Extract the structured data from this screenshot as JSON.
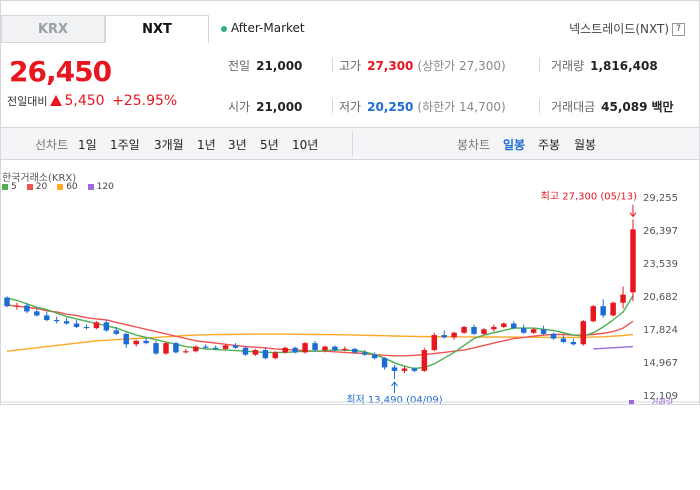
{
  "tabs": [
    {
      "label": "KRX",
      "active": false
    },
    {
      "label": "NXT",
      "active": true
    }
  ],
  "market_status": "After-Market",
  "venue_label": "넥스트레이드(NXT)",
  "venue_help": "?",
  "price": "26,450",
  "change": {
    "label": "전일대비",
    "amount": "5,450",
    "percent": "+25.95%"
  },
  "stats": {
    "prev_close": {
      "label": "전일",
      "value": "21,000"
    },
    "high": {
      "label": "고가",
      "value": "27,300",
      "note": "(상한가 27,300)"
    },
    "volume": {
      "label": "거래량",
      "value": "1,816,408"
    },
    "open": {
      "label": "시가",
      "value": "21,000"
    },
    "low": {
      "label": "저가",
      "value": "20,250",
      "note": "(하한가 14,700)"
    },
    "trade_value": {
      "label": "거래대금",
      "value": "45,089",
      "unit": "백만"
    }
  },
  "toolbar": {
    "line_label": "선차트",
    "line_periods": [
      "1일",
      "1주일",
      "3개월",
      "1년",
      "3년",
      "5년",
      "10년"
    ],
    "candle_label": "봉차트",
    "candle_periods": [
      "일봉",
      "주봉",
      "월봉"
    ],
    "selected_candle": "일봉"
  },
  "chart_data": {
    "type": "candlestick",
    "source_label": "한국거래소(KRX)",
    "legend": [
      {
        "name": "5",
        "color": "#4caf50"
      },
      {
        "name": "20",
        "color": "#ef5350"
      },
      {
        "name": "60",
        "color": "#ffa726"
      },
      {
        "name": "120",
        "color": "#9c6ade"
      }
    ],
    "y_ticks": [
      29255,
      26397,
      23539,
      20682,
      17824,
      14967,
      12109
    ],
    "y_tick_labels": [
      "29,255",
      "26,397",
      "23,539",
      "20,682",
      "17,824",
      "14,967",
      "12,109"
    ],
    "ylim": [
      12109,
      29255
    ],
    "colors": {
      "up": "#e8161f",
      "down": "#1d6cd6"
    },
    "annotations": {
      "high": {
        "label": "최고 27,300 (05/13)",
        "value": 27300,
        "index": 63
      },
      "low": {
        "label": "최저 13,490 (04/09)",
        "value": 13490,
        "index": 39
      }
    },
    "candles": [
      [
        20550,
        20650,
        19700,
        19800
      ],
      [
        19800,
        20100,
        19500,
        19850
      ],
      [
        19850,
        20050,
        19200,
        19350
      ],
      [
        19350,
        19600,
        18900,
        19000
      ],
      [
        19000,
        19300,
        18500,
        18600
      ],
      [
        18600,
        18900,
        18300,
        18500
      ],
      [
        18500,
        18800,
        18200,
        18300
      ],
      [
        18300,
        18600,
        17900,
        18000
      ],
      [
        18000,
        18200,
        17800,
        17900
      ],
      [
        17900,
        18500,
        17800,
        18400
      ],
      [
        18400,
        18600,
        17600,
        17700
      ],
      [
        17700,
        18000,
        17300,
        17400
      ],
      [
        17400,
        17500,
        16200,
        16500
      ],
      [
        16500,
        16900,
        16300,
        16800
      ],
      [
        16800,
        17100,
        16500,
        16600
      ],
      [
        16600,
        16800,
        15600,
        15700
      ],
      [
        15700,
        16700,
        15600,
        16600
      ],
      [
        16600,
        16700,
        15700,
        15800
      ],
      [
        15800,
        16100,
        15700,
        15900
      ],
      [
        15900,
        16400,
        15800,
        16300
      ],
      [
        16300,
        16500,
        16100,
        16200
      ],
      [
        16200,
        16400,
        16000,
        16100
      ],
      [
        16100,
        16500,
        16000,
        16400
      ],
      [
        16400,
        16600,
        16100,
        16200
      ],
      [
        16200,
        16300,
        15500,
        15600
      ],
      [
        15600,
        16100,
        15500,
        16000
      ],
      [
        16000,
        16200,
        15200,
        15300
      ],
      [
        15300,
        15900,
        15200,
        15800
      ],
      [
        15800,
        16300,
        15700,
        16200
      ],
      [
        16200,
        16300,
        15700,
        15800
      ],
      [
        15800,
        16700,
        15700,
        16600
      ],
      [
        16600,
        16800,
        15900,
        16000
      ],
      [
        16000,
        16400,
        15800,
        16300
      ],
      [
        16300,
        16400,
        15900,
        16000
      ],
      [
        16000,
        16300,
        15900,
        16100
      ],
      [
        16100,
        16200,
        15700,
        15800
      ],
      [
        15800,
        16000,
        15500,
        15600
      ],
      [
        15600,
        15800,
        15200,
        15300
      ],
      [
        15300,
        15400,
        14300,
        14500
      ],
      [
        14500,
        14700,
        13490,
        14200
      ],
      [
        14200,
        14600,
        14000,
        14400
      ],
      [
        14400,
        14500,
        14100,
        14200
      ],
      [
        14200,
        16200,
        14100,
        16000
      ],
      [
        16000,
        17500,
        15900,
        17300
      ],
      [
        17300,
        17700,
        17000,
        17100
      ],
      [
        17100,
        17600,
        16900,
        17500
      ],
      [
        17500,
        18100,
        17400,
        18000
      ],
      [
        18000,
        18200,
        17300,
        17400
      ],
      [
        17400,
        17900,
        17300,
        17800
      ],
      [
        17800,
        18200,
        17600,
        18000
      ],
      [
        18000,
        18400,
        17900,
        18300
      ],
      [
        18300,
        18500,
        17800,
        17900
      ],
      [
        17900,
        18200,
        17400,
        17500
      ],
      [
        17500,
        17900,
        17400,
        17800
      ],
      [
        17800,
        18100,
        17300,
        17400
      ],
      [
        17400,
        17500,
        16900,
        17000
      ],
      [
        17000,
        17300,
        16600,
        16700
      ],
      [
        16700,
        17000,
        16400,
        16500
      ],
      [
        16500,
        18600,
        16400,
        18500
      ],
      [
        18500,
        19900,
        18400,
        19800
      ],
      [
        19800,
        20400,
        18800,
        19000
      ],
      [
        19000,
        20200,
        18900,
        20100
      ],
      [
        20100,
        21500,
        19600,
        20800
      ],
      [
        21000,
        27300,
        20250,
        26450
      ]
    ],
    "ma_approx": {
      "ma5": [
        20500,
        20300,
        20000,
        19700,
        19500,
        19200,
        18900,
        18700,
        18500,
        18300,
        18100,
        17900,
        17600,
        17300,
        17100,
        16900,
        16700,
        16500,
        16300,
        16200,
        16100,
        16050,
        16000,
        15950,
        15900,
        15850,
        15800,
        15800,
        15800,
        15850,
        15900,
        15900,
        15950,
        16000,
        16000,
        15950,
        15850,
        15600,
        15300,
        14900,
        14600,
        14400,
        14500,
        14800,
        15300,
        15800,
        16400,
        17000,
        17300,
        17500,
        17700,
        17900,
        17900,
        17900,
        17800,
        17700,
        17500,
        17300,
        17200,
        17500,
        18000,
        18600,
        19300,
        20700
      ],
      "ma20": [
        19900,
        19800,
        19700,
        19600,
        19400,
        19300,
        19100,
        19000,
        18800,
        18700,
        18600,
        18400,
        18200,
        18000,
        17800,
        17600,
        17400,
        17200,
        17000,
        16800,
        16700,
        16600,
        16500,
        16400,
        16300,
        16250,
        16200,
        16100,
        16050,
        16000,
        15950,
        15900,
        15900,
        15850,
        15800,
        15750,
        15700,
        15600,
        15550,
        15500,
        15500,
        15550,
        15600,
        15700,
        15800,
        15900,
        16000,
        16200,
        16400,
        16600,
        16800,
        17000,
        17100,
        17200,
        17300,
        17350,
        17350,
        17300,
        17300,
        17350,
        17450,
        17600,
        17900,
        18500
      ],
      "ma60": [
        15900,
        16000,
        16100,
        16200,
        16300,
        16400,
        16500,
        16600,
        16700,
        16800,
        16850,
        16900,
        16950,
        17000,
        17050,
        17100,
        17150,
        17200,
        17250,
        17300,
        17320,
        17340,
        17350,
        17360,
        17370,
        17380,
        17380,
        17380,
        17380,
        17370,
        17360,
        17350,
        17340,
        17330,
        17320,
        17300,
        17280,
        17260,
        17240,
        17220,
        17200,
        17180,
        17170,
        17160,
        17150,
        17150,
        17140,
        17140,
        17130,
        17130,
        17120,
        17120,
        17110,
        17110,
        17100,
        17100,
        17100,
        17100,
        17100,
        17120,
        17150,
        17200,
        17250,
        17350
      ],
      "ma120_from": 59,
      "ma120": [
        16100,
        16150,
        16200,
        16250,
        16300
      ]
    },
    "footer_label": "거래량"
  }
}
